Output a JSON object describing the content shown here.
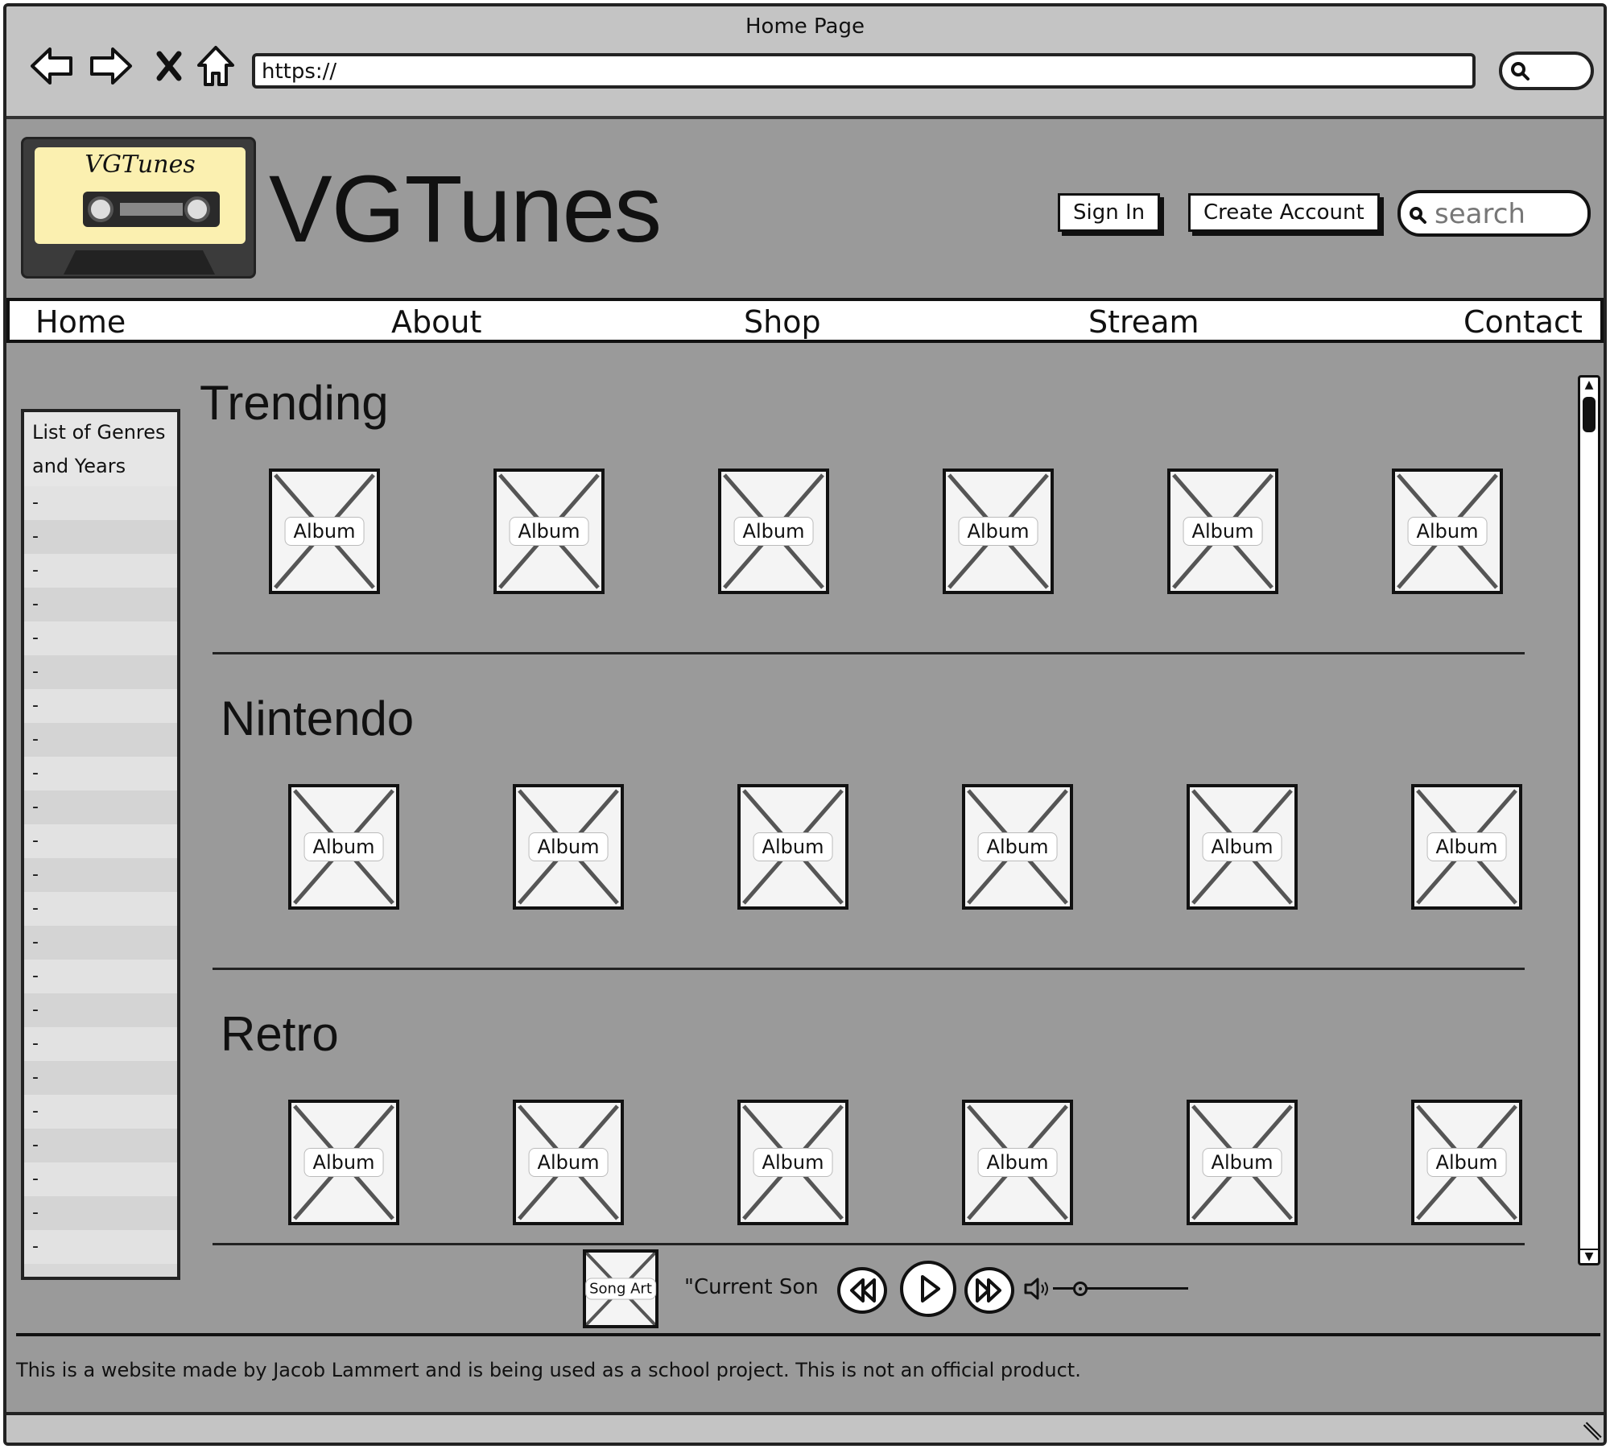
{
  "window": {
    "title": "Home Page"
  },
  "browser": {
    "url": "https://"
  },
  "header": {
    "logo_text": "VGTunes",
    "brand": "VGTunes",
    "sign_in": "Sign In",
    "create_account": "Create Account",
    "search_placeholder": "search"
  },
  "nav": [
    "Home",
    "About",
    "Shop",
    "Stream",
    "Contact"
  ],
  "sidebar": {
    "heading_line1": "List of Genres",
    "heading_line2": "and Years",
    "items": [
      "-",
      "-",
      "-",
      "-",
      "-",
      "-",
      "-",
      "-",
      "-",
      "-",
      "-",
      "-",
      "-",
      "-",
      "-",
      "-",
      "-",
      "-",
      "-",
      "-",
      "-",
      "-",
      "-"
    ]
  },
  "sections": [
    {
      "title": "Trending",
      "albums": [
        "Album",
        "Album",
        "Album",
        "Album",
        "Album",
        "Album"
      ]
    },
    {
      "title": "Nintendo",
      "albums": [
        "Album",
        "Album",
        "Album",
        "Album",
        "Album",
        "Album"
      ]
    },
    {
      "title": "Retro",
      "albums": [
        "Album",
        "Album",
        "Album",
        "Album",
        "Album",
        "Album"
      ]
    }
  ],
  "player": {
    "song_art": "Song Art",
    "current_song": "\"Current Son",
    "volume_level": 0.2
  },
  "footer": {
    "text": "This is a website made by Jacob Lammert and is being used as a school project. This is not an official product."
  },
  "icons": [
    "back-arrow-icon",
    "forward-arrow-icon",
    "close-icon",
    "home-icon",
    "search-icon",
    "rewind-icon",
    "play-icon",
    "fast-forward-icon",
    "speaker-icon",
    "resize-grip-icon"
  ]
}
